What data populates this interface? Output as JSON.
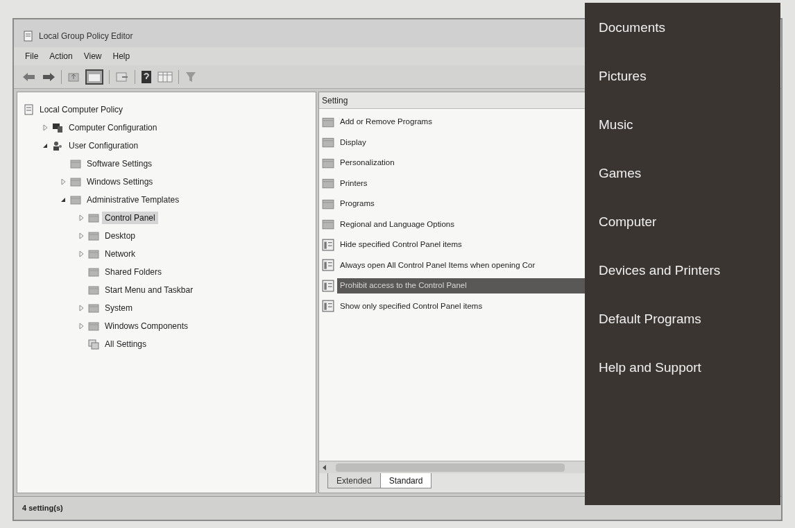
{
  "window": {
    "title": "Local Group Policy Editor"
  },
  "menu": [
    "File",
    "Action",
    "View",
    "Help"
  ],
  "tree": [
    {
      "label": "Local Computer Policy",
      "kind": "policy",
      "selected": false,
      "children": [
        {
          "label": "Computer Configuration",
          "kind": "computer",
          "expanded": false,
          "selected": false
        },
        {
          "label": "User Configuration",
          "kind": "user",
          "expanded": true,
          "selected": false,
          "children": [
            {
              "label": "Software Settings",
              "kind": "folder",
              "selected": false
            },
            {
              "label": "Windows Settings",
              "kind": "folder",
              "expanded": false,
              "selected": false
            },
            {
              "label": "Administrative Templates",
              "kind": "folder",
              "expanded": true,
              "selected": false,
              "children": [
                {
                  "label": "Control Panel",
                  "kind": "folder",
                  "expanded": false,
                  "selected": true
                },
                {
                  "label": "Desktop",
                  "kind": "folder",
                  "expanded": false,
                  "selected": false
                },
                {
                  "label": "Network",
                  "kind": "folder",
                  "expanded": false,
                  "selected": false
                },
                {
                  "label": "Shared Folders",
                  "kind": "folder",
                  "selected": false
                },
                {
                  "label": "Start Menu and Taskbar",
                  "kind": "folder",
                  "selected": false
                },
                {
                  "label": "System",
                  "kind": "folder",
                  "expanded": false,
                  "selected": false
                },
                {
                  "label": "Windows Components",
                  "kind": "folder",
                  "expanded": false,
                  "selected": false
                },
                {
                  "label": "All Settings",
                  "kind": "settings",
                  "selected": false
                }
              ]
            }
          ]
        }
      ]
    }
  ],
  "settings": {
    "column": "Setting",
    "rows": [
      {
        "label": "Add or Remove Programs",
        "kind": "folder",
        "selected": false
      },
      {
        "label": "Display",
        "kind": "folder",
        "selected": false
      },
      {
        "label": "Personalization",
        "kind": "folder",
        "selected": false
      },
      {
        "label": "Printers",
        "kind": "folder",
        "selected": false
      },
      {
        "label": "Programs",
        "kind": "folder",
        "selected": false
      },
      {
        "label": "Regional and Language Options",
        "kind": "folder",
        "selected": false
      },
      {
        "label": "Hide specified Control Panel items",
        "kind": "policy",
        "selected": false
      },
      {
        "label": "Always open All Control Panel Items when opening Cor",
        "kind": "policy",
        "selected": false
      },
      {
        "label": "Prohibit access to the Control Panel",
        "kind": "policy",
        "selected": true
      },
      {
        "label": "Show only specified Control Panel items",
        "kind": "policy",
        "selected": false
      }
    ]
  },
  "tabs": [
    {
      "label": "Extended",
      "selected": false
    },
    {
      "label": "Standard",
      "selected": true
    }
  ],
  "status_bar": "4 setting(s)",
  "start_menu": [
    "Documents",
    "Pictures",
    "Music",
    "Games",
    "Computer",
    "Devices and Printers",
    "Default Programs",
    "Help and Support"
  ]
}
